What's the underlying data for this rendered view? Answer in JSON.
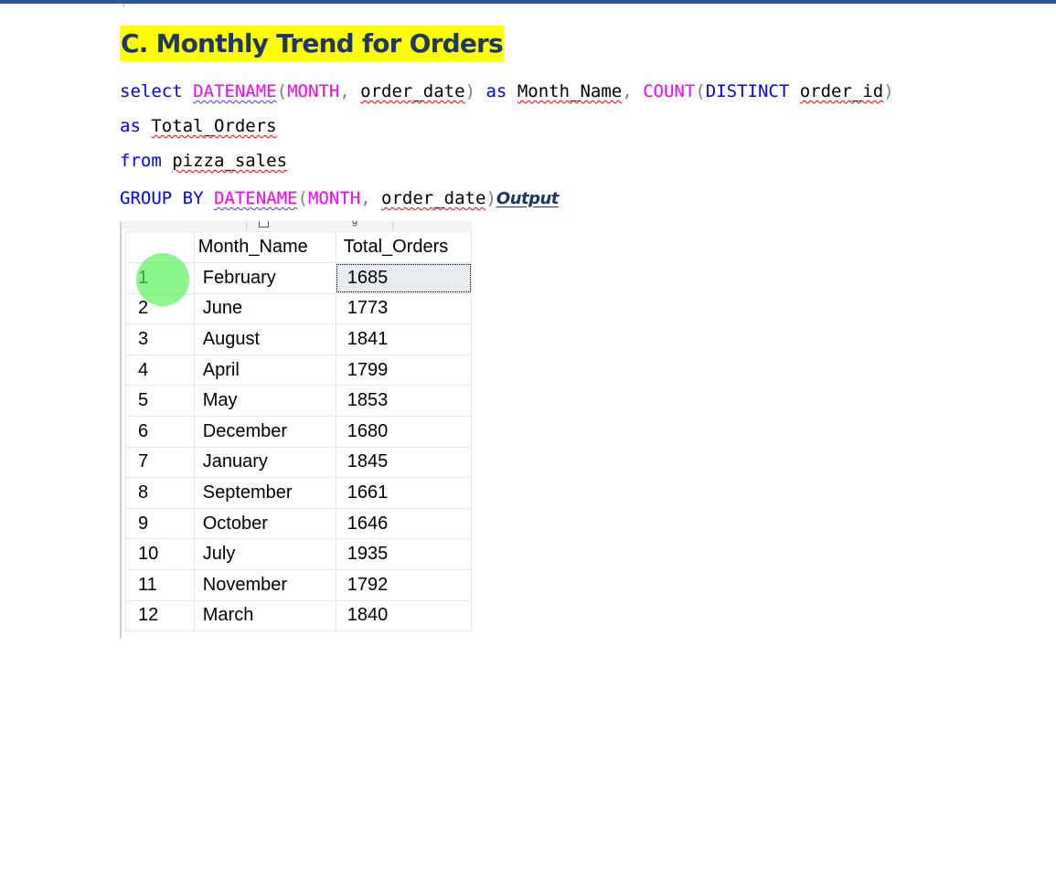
{
  "heading": "C. Monthly Trend for Orders",
  "query": {
    "line1": {
      "kw_select": "select",
      "fn_datename": "DATENAME",
      "p_open": "(",
      "fn_month": "MONTH",
      "comma": ",",
      "col_order_date": "order_date",
      "p_close": ")",
      "kw_as": "as",
      "alias_month_name": "Month_Name",
      "fn_count": "COUNT",
      "p_open2": "(",
      "kw_distinct": "DISTINCT",
      "col_order_id": "order_id",
      "p_close2": ")"
    },
    "line2": {
      "kw_as": "as",
      "alias_total_orders": "Total_Orders"
    },
    "line3": {
      "kw_from": "from",
      "table_name": "pizza_sales"
    },
    "line4": {
      "kw_group_by": "GROUP BY",
      "fn_datename": "DATENAME",
      "p_open": "(",
      "fn_month": "MONTH",
      "comma": ",",
      "col_order_date": "order_date",
      "p_close": ")"
    }
  },
  "output_label": "Output",
  "results": {
    "columns": [
      "Month_Name",
      "Total_Orders"
    ],
    "rows": [
      {
        "num": "1",
        "month": "February",
        "orders": "1685"
      },
      {
        "num": "2",
        "month": "June",
        "orders": "1773"
      },
      {
        "num": "3",
        "month": "August",
        "orders": "1841"
      },
      {
        "num": "4",
        "month": "April",
        "orders": "1799"
      },
      {
        "num": "5",
        "month": "May",
        "orders": "1853"
      },
      {
        "num": "6",
        "month": "December",
        "orders": "1680"
      },
      {
        "num": "7",
        "month": "January",
        "orders": "1845"
      },
      {
        "num": "8",
        "month": "September",
        "orders": "1661"
      },
      {
        "num": "9",
        "month": "October",
        "orders": "1646"
      },
      {
        "num": "10",
        "month": "July",
        "orders": "1935"
      },
      {
        "num": "11",
        "month": "November",
        "orders": "1792"
      },
      {
        "num": "12",
        "month": "March",
        "orders": "1840"
      }
    ]
  },
  "colors": {
    "keyword": "#0000ff",
    "function": "#ff00ff",
    "punctuation": "#808080",
    "heading_text": "#1f3763",
    "heading_highlight": "#ffff00",
    "top_bar": "#2b579a",
    "click_highlight": "#50f050"
  }
}
